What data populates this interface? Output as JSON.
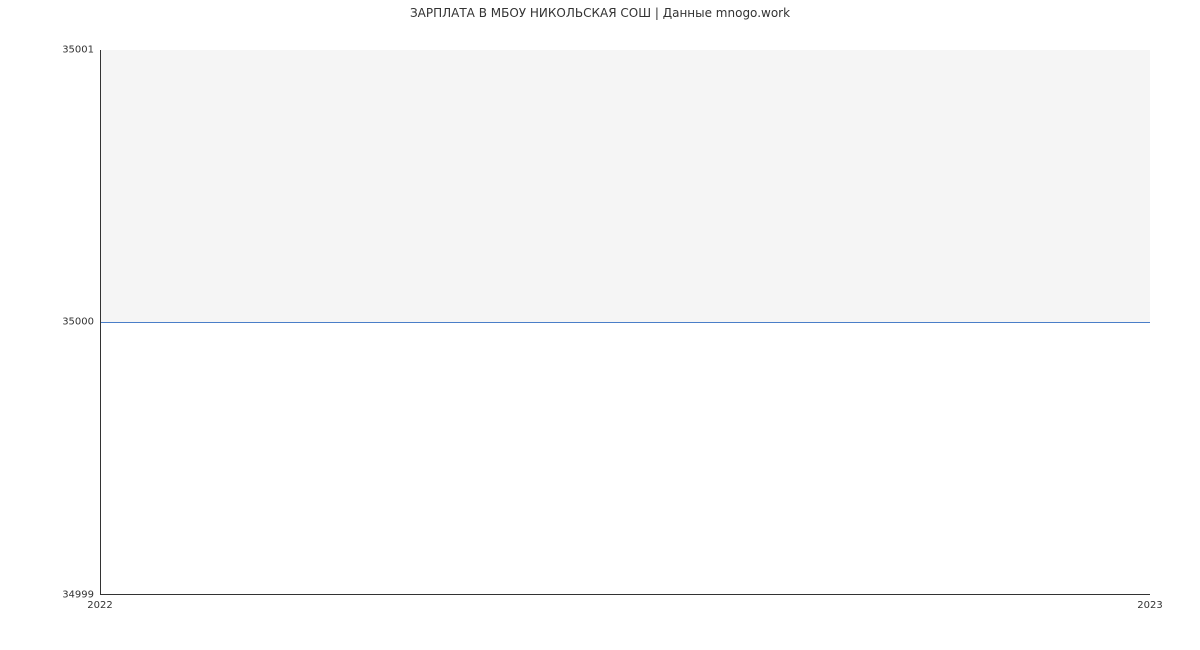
{
  "chart_data": {
    "type": "line",
    "title": "ЗАРПЛАТА В МБОУ НИКОЛЬСКАЯ СОШ | Данные mnogo.work",
    "xlabel": "",
    "ylabel": "",
    "categories": [
      "2022",
      "2023"
    ],
    "values": [
      35000,
      35000
    ],
    "ylim": [
      34999,
      35001
    ],
    "yticks": [
      34999,
      35000,
      35001
    ],
    "colors": {
      "line": "#4a7ec8"
    }
  }
}
